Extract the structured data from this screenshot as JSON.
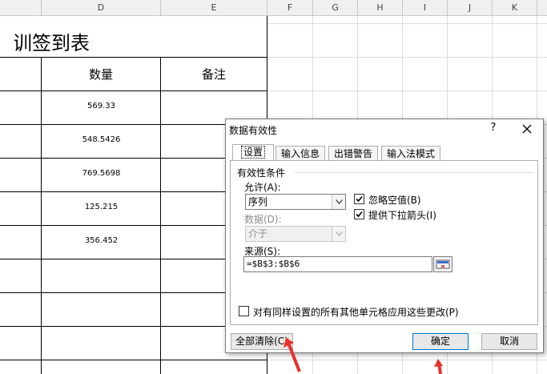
{
  "columns": [
    "D",
    "E",
    "F",
    "G",
    "H",
    "I",
    "J",
    "K"
  ],
  "sheet": {
    "title": "培训签到表",
    "headers": {
      "qty": "数量",
      "note": "备注"
    },
    "quantities": [
      "569.33",
      "548.5426",
      "769.5698",
      "125.215",
      "356.452"
    ]
  },
  "dialog": {
    "title": "数据有效性",
    "help": "?",
    "tabs": [
      "设置",
      "输入信息",
      "出错警告",
      "输入法模式"
    ],
    "group_label": "有效性条件",
    "allow_label": "允许(A):",
    "allow_value": "序列",
    "data_label": "数据(D):",
    "data_value": "介于",
    "ignore_blank": "忽略空值(B)",
    "dropdown": "提供下拉箭头(I)",
    "source_label": "来源(S):",
    "source_value": "=$B$3:$B$6",
    "apply_all": "对有同样设置的所有其他单元格应用这些更改(P)",
    "clear_all": "全部清除(C)",
    "ok": "确定",
    "cancel": "取消"
  },
  "colors": {
    "accent": "#0078d7",
    "arrow": "#e8312a"
  }
}
